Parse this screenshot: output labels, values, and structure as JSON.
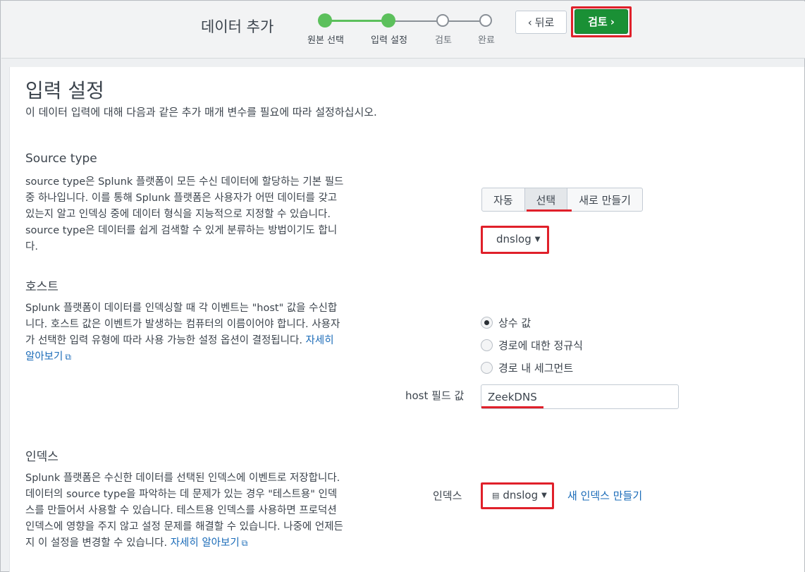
{
  "header": {
    "title": "데이터 추가",
    "steps": [
      {
        "label": "원본 선택",
        "state": "done"
      },
      {
        "label": "입력 설정",
        "state": "done"
      },
      {
        "label": "검토",
        "state": "todo"
      },
      {
        "label": "완료",
        "state": "todo"
      }
    ],
    "back_label": "뒤로",
    "next_label": "검토",
    "accent_color": "#5cc05c",
    "next_color": "#1a9035",
    "highlight_color": "#e0202a"
  },
  "page": {
    "title": "입력 설정",
    "subtitle": "이 데이터 입력에 대해 다음과 같은 추가 매개 변수를 필요에 따라 설정하십시오."
  },
  "source_type": {
    "title": "Source type",
    "description": "source type은 Splunk 플랫폼이 모든 수신 데이터에 할당하는 기본 필드 중 하나입니다. 이를 통해 Splunk 플랫폼은 사용자가 어떤 데이터를 갖고 있는지 알고 인덱싱 중에 데이터 형식을 지능적으로 지정할 수 있습니다. source type은 데이터를 쉽게 검색할 수 있게 분류하는 방법이기도 합니다.",
    "modes": [
      "자동",
      "선택",
      "새로 만들기"
    ],
    "selected_mode": "선택",
    "selected_value": "dnslog"
  },
  "host": {
    "title": "호스트",
    "description": "Splunk 플랫폼이 데이터를 인덱싱할 때 각 이벤트는 \"host\" 값을 수신합니다. 호스트 값은 이벤트가 발생하는 컴퓨터의 이름이어야 합니다. 사용자가 선택한 입력 유형에 따라 사용 가능한 설정 옵션이 결정됩니다.",
    "learn_more": "자세히 알아보기",
    "options": [
      "상수 값",
      "경로에 대한 정규식",
      "경로 내 세그먼트"
    ],
    "selected_option": "상수 값",
    "field_label": "host 필드 값",
    "field_value": "ZeekDNS"
  },
  "index": {
    "title": "인덱스",
    "description": "Splunk 플랫폼은 수신한 데이터를 선택된 인덱스에 이벤트로 저장합니다. 데이터의 source type을 파악하는 데 문제가 있는 경우 \"테스트용\" 인덱스를 만들어서 사용할 수 있습니다. 테스트용 인덱스를 사용하면 프로덕션 인덱스에 영향을 주지 않고 설정 문제를 해결할 수 있습니다. 나중에 언제든지 이 설정을 변경할 수 있습니다.",
    "learn_more": "자세히 알아보기",
    "field_label": "인덱스",
    "selected_value": "dnslog",
    "create_link": "새 인덱스 만들기"
  }
}
